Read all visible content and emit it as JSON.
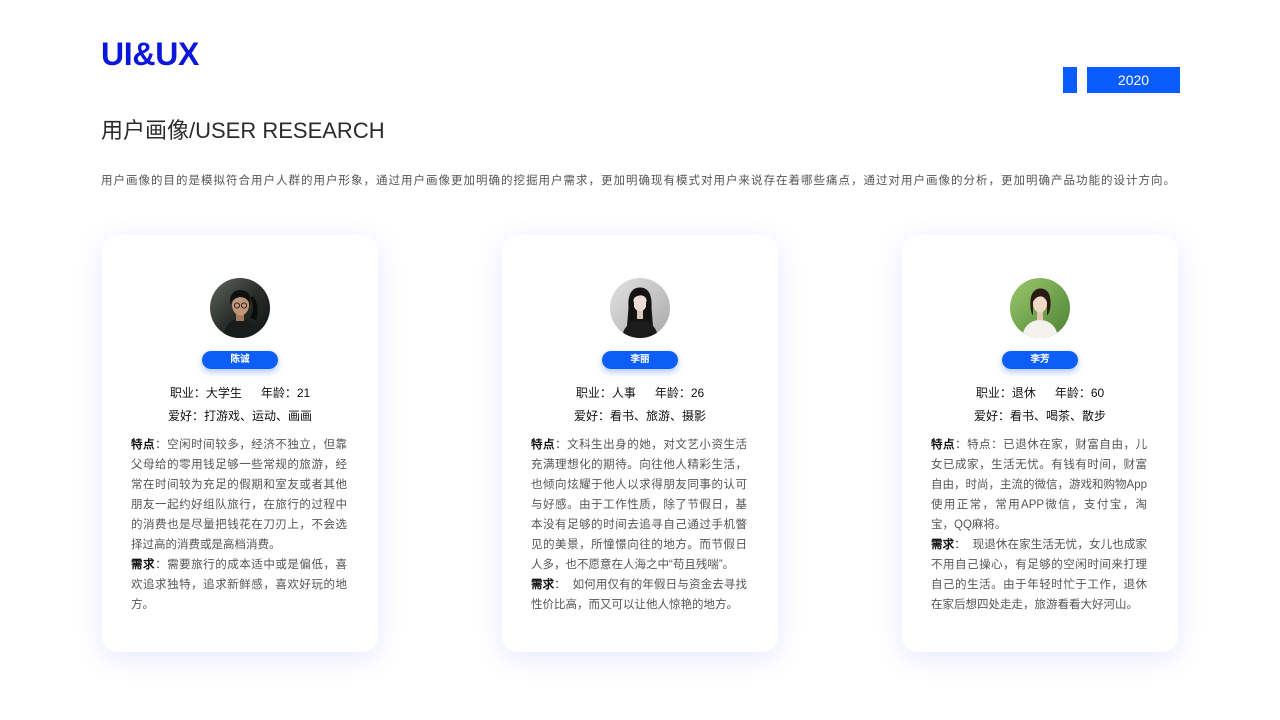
{
  "header": {
    "logo": "UI&UX",
    "year": "2020",
    "title": "用户画像/USER RESEARCH",
    "description": "用户画像的目的是模拟符合用户人群的用户形象，通过用户画像更加明确的挖掘用户需求，更加明确现有模式对用户来说存在着哪些痛点，通过对用户画像的分析，更加明确产品功能的设计方向。"
  },
  "colors": {
    "logo": "#0b17d8",
    "accent": "#0a5cff"
  },
  "personas": [
    {
      "name": "陈诚",
      "occupation": "职业：大学生",
      "age": "年龄：21",
      "hobbies": "爱好：打游戏、运动、画画",
      "traits_label": "特点",
      "traits": "：空闲时间较多，经济不独立，但靠父母给的零用钱足够一些常规的旅游，经常在时间较为充足的假期和室友或者其他朋友一起约好组队旅行，在旅行的过程中的消费也是尽量把钱花在刀刃上，不会选择过高的消费或是高档消费。",
      "needs_label": "需求",
      "needs": "：需要旅行的成本适中或是偏低，喜欢追求独特，追求新鲜感，喜欢好玩的地方。"
    },
    {
      "name": "李丽",
      "occupation": "职业：人事",
      "age": "年龄：26",
      "hobbies": "爱好：看书、旅游、摄影",
      "traits_label": "特点",
      "traits": "：文科生出身的她，对文艺小资生活充满理想化的期待。向往他人精彩生活，也倾向炫耀于他人以求得朋友同事的认可与好感。由于工作性质，除了节假日，基本没有足够的时间去追寻自己通过手机瞥见的美景，所憧憬向往的地方。而节假日人多，也不愿意在人海之中“苟且残喘”。",
      "needs_label": "需求",
      "needs": "：  如何用仅有的年假日与资金去寻找性价比高，而又可以让他人惊艳的地方。"
    },
    {
      "name": "李芳",
      "occupation": "职业：退休",
      "age": "年龄：60",
      "hobbies": "爱好：看书、喝茶、散步",
      "traits_label": "特点",
      "traits": "：特点：已退休在家，财富自由，儿女已成家，生活无忧。有钱有时间，财富自由，时尚，主流的微信，游戏和购物App使用正常，常用APP微信，支付宝，淘宝，QQ麻将。",
      "needs_label": "需求",
      "needs": "：  现退休在家生活无忧，女儿也成家不用自己操心，有足够的空闲时间来打理自己的生活。由于年轻时忙于工作，退休在家后想四处走走，旅游看看大好河山。"
    }
  ]
}
